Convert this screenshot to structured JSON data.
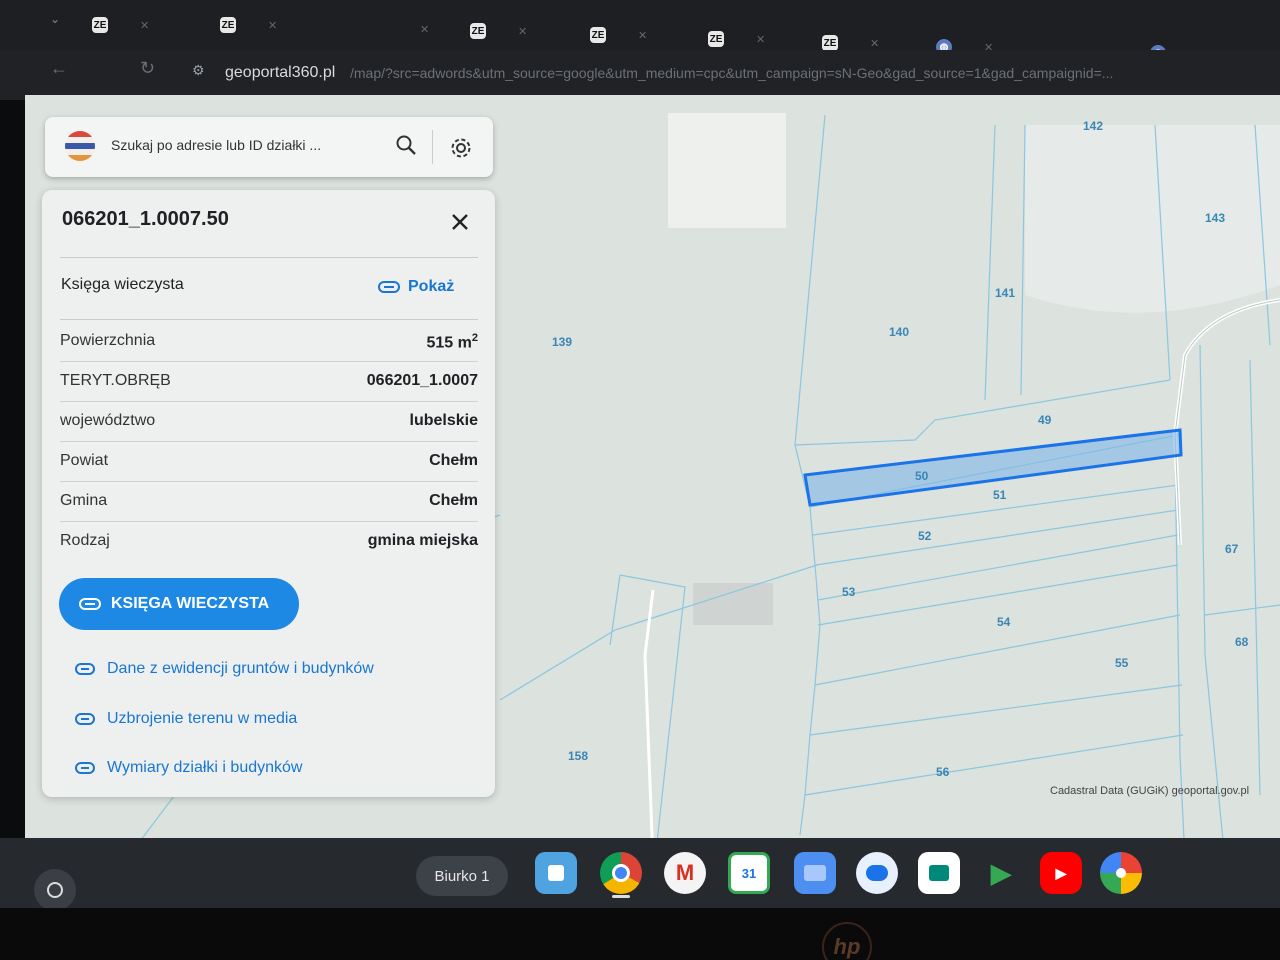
{
  "browser": {
    "tabs": [
      {
        "favicon": "ZE"
      },
      {
        "favicon": "ZE"
      },
      {
        "favicon": "ZE"
      },
      {
        "favicon": "ZE"
      },
      {
        "favicon": "ZE"
      },
      {
        "favicon": "ZE"
      },
      {
        "favicon": "ZE"
      },
      {
        "favicon": "globe"
      },
      {
        "favicon": "globe"
      }
    ],
    "url_host": "geoportal360.pl",
    "url_path": "/map/?src=adwords&utm_source=google&utm_medium=cpc&utm_campaign=sN-Geo&gad_source=1&gad_campaignid=..."
  },
  "search": {
    "placeholder": "Szukaj po adresie lub ID działki ..."
  },
  "panel": {
    "parcel_id": "066201_1.0007.50",
    "land_register_label": "Księga wieczysta",
    "show_label": "Pokaż",
    "rows": [
      {
        "key": "Powierzchnia",
        "value": "515 m",
        "sup": "2"
      },
      {
        "key": "TERYT.OBRĘB",
        "value": "066201_1.0007"
      },
      {
        "key": "województwo",
        "value": "lubelskie"
      },
      {
        "key": "Powiat",
        "value": "Chełm"
      },
      {
        "key": "Gmina",
        "value": "Chełm"
      },
      {
        "key": "Rodzaj",
        "value": "gmina miejska"
      }
    ],
    "button_label": "KSIĘGA WIECZYSTA",
    "links": [
      "Dane z ewidencji gruntów i budynków",
      "Uzbrojenie terenu w media",
      "Wymiary działki i budynków"
    ]
  },
  "map": {
    "plot_numbers": [
      "139",
      "140",
      "141",
      "142",
      "143",
      "49",
      "50",
      "51",
      "52",
      "53",
      "54",
      "55",
      "56",
      "67",
      "68",
      "158"
    ],
    "attribution": "Cadastral Data (GUGiK) geoportal.gov.pl",
    "parcel_line_color": "#7ec7e6",
    "selected_color": "#1a73e8"
  },
  "shelf": {
    "desk_label": "Biurko 1",
    "apps": [
      "remote-desktop",
      "chrome",
      "gmail",
      "calendar",
      "files",
      "messages",
      "meet",
      "play-store",
      "youtube",
      "photos"
    ]
  }
}
